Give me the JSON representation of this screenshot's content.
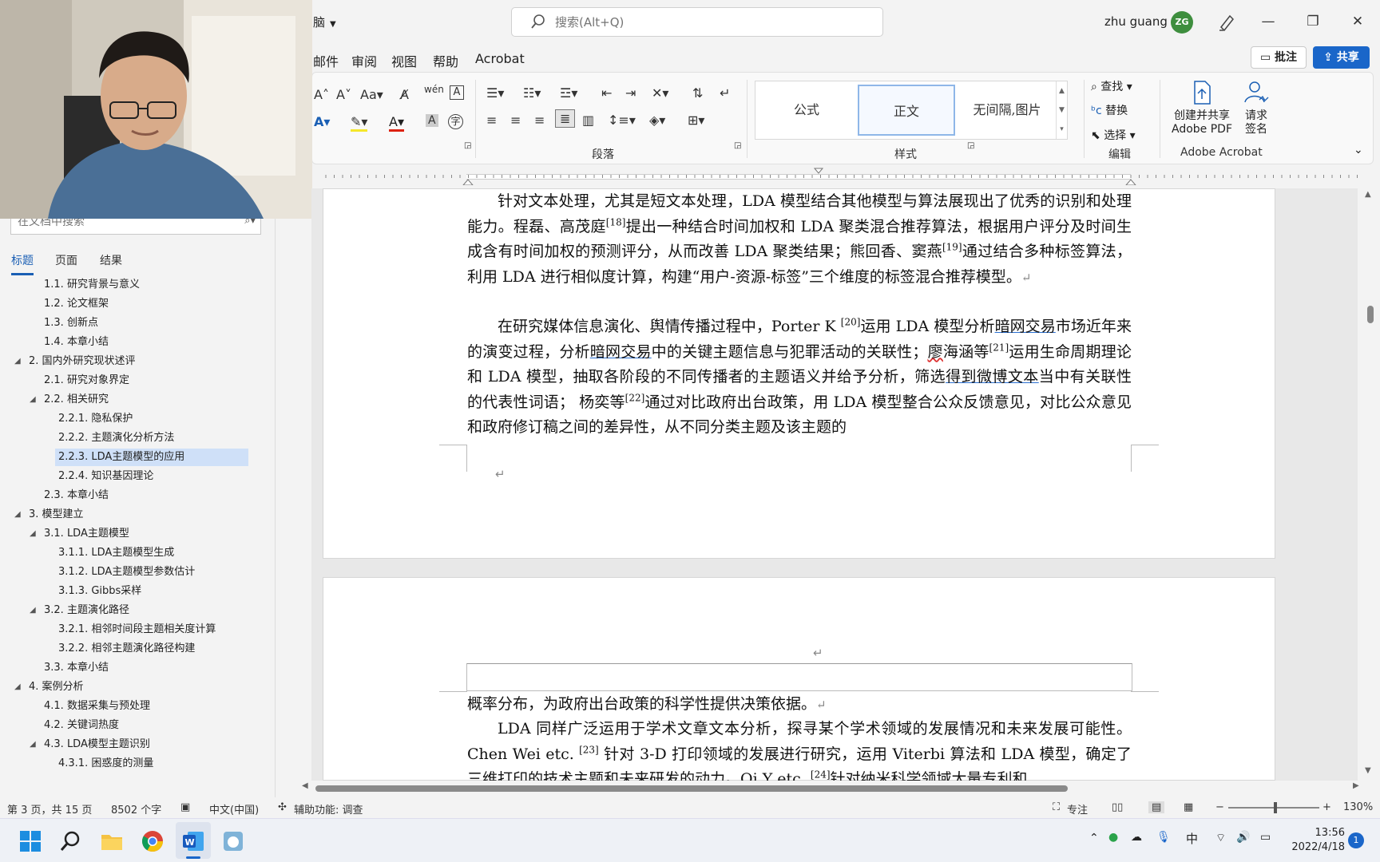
{
  "titlebar": {
    "doc_title": "脑",
    "search_placeholder": "搜索(Alt+Q)",
    "user_name": "zhu guang",
    "user_initials": "ZG"
  },
  "menu": {
    "items": [
      "邮件",
      "审阅",
      "视图",
      "帮助",
      "Acrobat"
    ],
    "comments": "批注",
    "share": "共享"
  },
  "ribbon": {
    "groups": {
      "paragraph": "段落",
      "styles": "样式",
      "editing": "编辑",
      "acrobat": "Adobe Acrobat"
    },
    "styles": [
      "公式",
      "正文",
      "无间隔,图片"
    ],
    "editing": {
      "find": "查找",
      "replace": "替换",
      "select": "选择"
    },
    "acrobat": {
      "create_line1": "创建并共享",
      "create_line2": "Adobe PDF",
      "sign_line1": "请求",
      "sign_line2": "签名"
    }
  },
  "nav": {
    "search_placeholder": "在文档中搜索",
    "tabs": [
      "标题",
      "页面",
      "结果"
    ],
    "items": [
      {
        "label": "1.1. 研究背景与意义"
      },
      {
        "label": "1.2. 论文框架"
      },
      {
        "label": "1.3. 创新点"
      },
      {
        "label": "1.4. 本章小结"
      },
      {
        "label": "2. 国内外研究现状述评"
      },
      {
        "label": "2.1. 研究对象界定"
      },
      {
        "label": "2.2. 相关研究"
      },
      {
        "label": "2.2.1. 隐私保护"
      },
      {
        "label": "2.2.2. 主题演化分析方法"
      },
      {
        "label": "2.2.3. LDA主题模型的应用"
      },
      {
        "label": "2.2.4. 知识基因理论"
      },
      {
        "label": "2.3. 本章小结"
      },
      {
        "label": "3. 模型建立"
      },
      {
        "label": "3.1. LDA主题模型"
      },
      {
        "label": "3.1.1. LDA主题模型生成"
      },
      {
        "label": "3.1.2. LDA主题模型参数估计"
      },
      {
        "label": "3.1.3. Gibbs采样"
      },
      {
        "label": "3.2. 主题演化路径"
      },
      {
        "label": "3.2.1. 相邻时间段主题相关度计算"
      },
      {
        "label": "3.2.2. 相邻主题演化路径构建"
      },
      {
        "label": "3.3. 本章小结"
      },
      {
        "label": "4. 案例分析"
      },
      {
        "label": "4.1. 数据采集与预处理"
      },
      {
        "label": "4.2. 关键词热度"
      },
      {
        "label": "4.3. LDA模型主题识别"
      },
      {
        "label": "4.3.1. 困惑度的测量"
      }
    ]
  },
  "document": {
    "p1": {
      "a": "针对文本处理，尤其是短文本处理，LDA 模型结合其他模型与算法展现出了优秀的识别和处理能力。程磊、高茂庭",
      "s1": "[18]",
      "b": "提出一种结合时间加权和 LDA 聚类混合推荐算法，根据用户评分及时间生成含有时间加权的预测评分，从而改善 LDA 聚类结果；熊回香、窦燕",
      "s2": "[19]",
      "c": "通过结合多种标签算法，利用 LDA 进行相似度计算，构建“用户-资源-标签”三个维度的标签混合推荐模型。"
    },
    "p2": {
      "a": "在研究媒体信息演化、舆情传播过程中，Porter K ",
      "s1": "[20]",
      "b": "运用 LDA 模型分析",
      "u1": "暗网交易",
      "c": "市场近年来的演变过程，分析",
      "u2": "暗网交易",
      "d": "中的关键主题信息与犯罪活动的关联性；",
      "w1": "廖",
      "e": "海涵等",
      "s2": "[21]",
      "f": "运用生命周期理论和 LDA 模型，抽取各阶段的不同传播者的主题语义并给予分析，筛选",
      "u3": "得到微博文本",
      "g": "当中有关联性的代表性词语； 杨奕等",
      "s3": "[22]",
      "h": "通过对比政府出台政策，用 LDA 模型整合公众反馈意见，对比公众意见和政府修订稿之间的差异性，从不同分类主题及该主题的"
    },
    "p3": "概率分布，为政府出台政策的科学性提供决策依据。",
    "p4": {
      "a": "LDA 同样广泛运用于学术文章文本分析，探寻某个学术领域的发展情况和未来发展可能性。Chen Wei etc. ",
      "s1": "[23]",
      "b": " 针对 3-D 打印领域的发展进行研究，运用 Viterbi 算法和 LDA 模型，确定了三维打印的技术主题和未来研发的动力。Qi Y etc. ",
      "s2": "[24]",
      "c": "针对纳米科学领域大量专利和"
    }
  },
  "status": {
    "page": "第 3 页，共 15 页",
    "words": "8502 个字",
    "language": "中文(中国)",
    "accessibility": "辅助功能: 调查",
    "focus": "专注",
    "zoom": "130%"
  },
  "taskbar": {
    "time": "13:56",
    "date": "2022/4/18",
    "ime": "中",
    "notif": "1"
  }
}
